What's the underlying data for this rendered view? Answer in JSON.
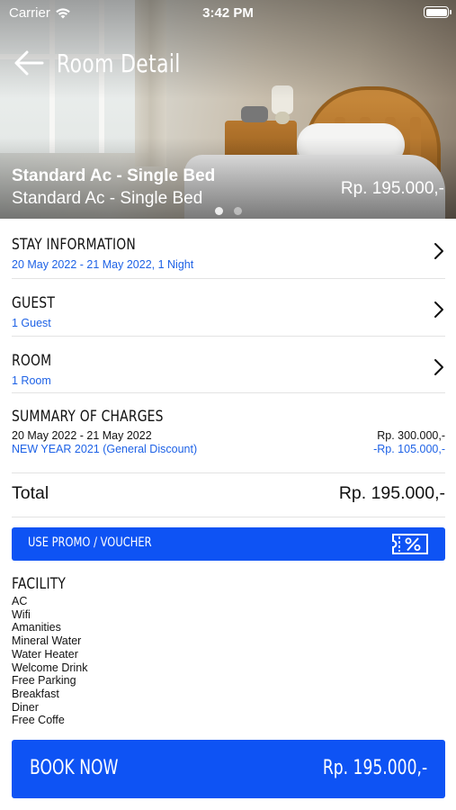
{
  "status_bar": {
    "carrier": "Carrier",
    "time": "3:42 PM"
  },
  "header": {
    "title": "Room Detail"
  },
  "hero": {
    "room_name": "Standard Ac - Single Bed",
    "room_subtitle": "Standard Ac - Single Bed",
    "price": "Rp. 195.000,-",
    "carousel_pages": 2,
    "carousel_active": 1
  },
  "stay_information": {
    "heading": "STAY INFORMATION",
    "value": "20 May 2022 - 21 May 2022, 1 Night"
  },
  "guest": {
    "heading": "GUEST",
    "value": "1 Guest"
  },
  "room": {
    "heading": "ROOM",
    "value": "1 Room"
  },
  "summary": {
    "heading": "SUMMARY OF CHARGES",
    "lines": [
      {
        "label": "20 May 2022 - 21 May 2022",
        "amount": "Rp. 300.000,-"
      },
      {
        "label": "NEW YEAR 2021 (General Discount)",
        "amount": "-Rp. 105.000,-"
      }
    ]
  },
  "total": {
    "label": "Total",
    "amount": "Rp. 195.000,-"
  },
  "promo": {
    "label": "USE PROMO / VOUCHER",
    "icon": "voucher-icon"
  },
  "facility": {
    "heading": "FACILITY",
    "items": [
      "AC",
      "Wifi",
      "Amanities",
      "Mineral Water",
      "Water Heater",
      "Welcome Drink",
      "Free Parking",
      "Breakfast",
      "Diner",
      "Free Coffe"
    ]
  },
  "book": {
    "label": "BOOK NOW",
    "price": "Rp. 195.000,-"
  },
  "colors": {
    "primary": "#0e53f4",
    "link": "#1e62e6"
  }
}
